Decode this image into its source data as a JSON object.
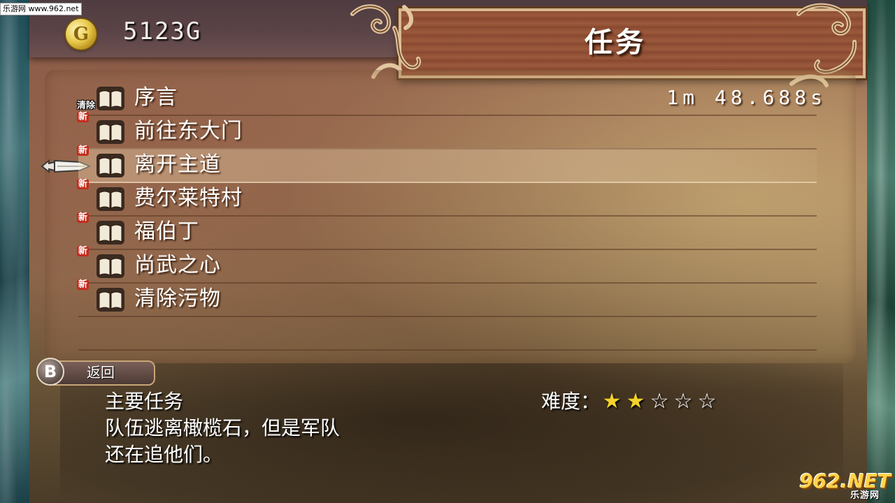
{
  "watermark": {
    "site": "乐游网 www.962.net",
    "logo_main": "962.NET",
    "logo_sub": "乐游网"
  },
  "header": {
    "gold_icon_letter": "G",
    "gold_amount": "5123G",
    "title": "任务"
  },
  "quest_list": {
    "selected_index": 2,
    "items": [
      {
        "label": "序言",
        "badge": "清除",
        "time": "1m  48.688s"
      },
      {
        "label": "前往东大门",
        "badge": "新",
        "time": ""
      },
      {
        "label": "离开主道",
        "badge": "新",
        "time": ""
      },
      {
        "label": "费尔莱特村",
        "badge": "新",
        "time": ""
      },
      {
        "label": "福伯丁",
        "badge": "新",
        "time": ""
      },
      {
        "label": "尚武之心",
        "badge": "新",
        "time": ""
      },
      {
        "label": "清除污物",
        "badge": "新",
        "time": ""
      }
    ]
  },
  "back_button": {
    "key": "B",
    "label": "返回"
  },
  "details": {
    "type": "主要任务",
    "description_line1": "队伍逃离橄榄石，但是军队",
    "description_line2": "还在追他们。",
    "difficulty_label": "难度：",
    "difficulty_stars": 2,
    "difficulty_max": 5
  },
  "colors": {
    "star_filled": "#f3d22a",
    "new_badge": "#c42a1a",
    "title_frame": "#9b5a3c"
  }
}
